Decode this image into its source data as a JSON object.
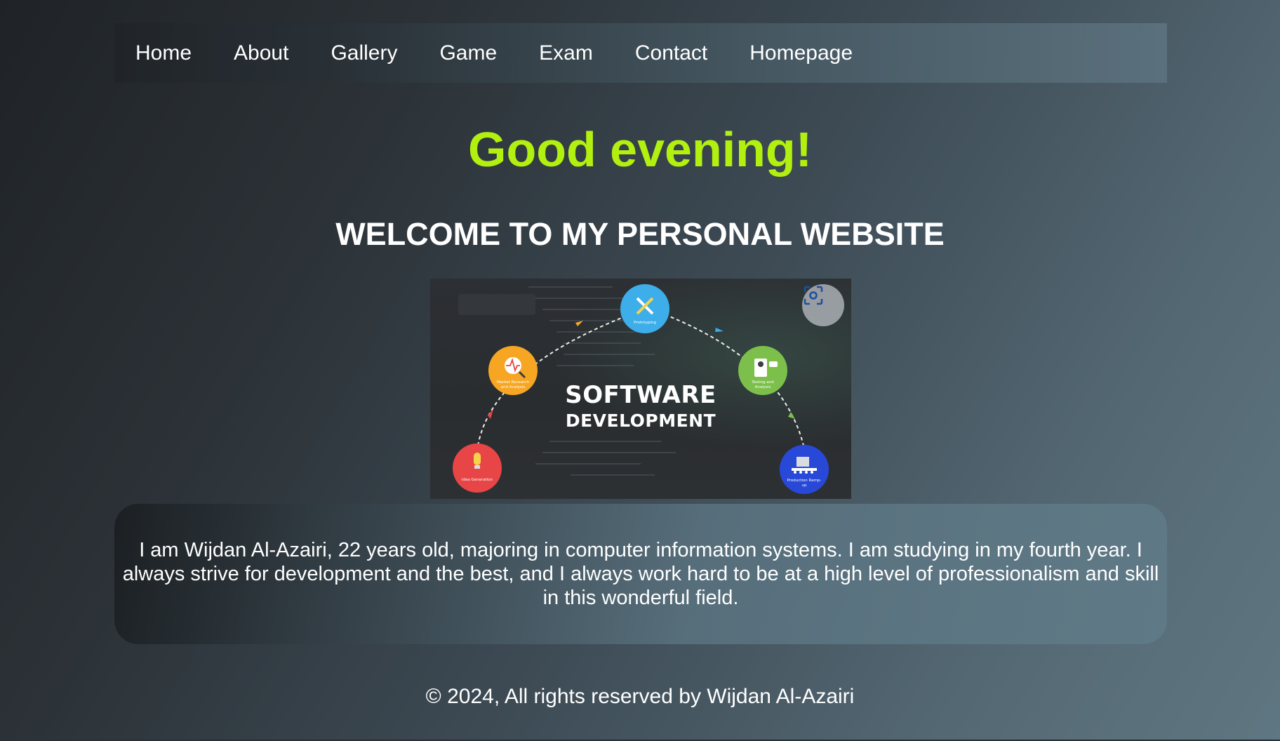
{
  "nav": {
    "items": [
      {
        "label": "Home"
      },
      {
        "label": "About"
      },
      {
        "label": "Gallery"
      },
      {
        "label": "Game"
      },
      {
        "label": "Exam"
      },
      {
        "label": "Contact"
      },
      {
        "label": "Homepage"
      }
    ]
  },
  "greeting": "Good evening!",
  "welcome": "WELCOME TO MY PERSONAL WEBSITE",
  "hero": {
    "title_line1": "SOFTWARE",
    "title_line2": "DEVELOPMENT",
    "stages": [
      {
        "label": "Idea Generation",
        "color": "#e84546"
      },
      {
        "label": "Market Research and Analysis",
        "color": "#f6a623"
      },
      {
        "label": "Prototyping",
        "color": "#3daee9"
      },
      {
        "label": "Testing and Analysis",
        "color": "#7cc04b"
      },
      {
        "label": "Production Ramp-up",
        "color": "#2848d8"
      }
    ]
  },
  "about": {
    "text": "I am Wijdan Al-Azairi, 22 years old, majoring in computer information systems. I am studying in my fourth year. I always strive for development and the best, and I always work hard to be at a high level of professionalism and skill in this wonderful field."
  },
  "footer": {
    "text": "© 2024, All rights reserved by Wijdan Al-Azairi"
  },
  "colors": {
    "greeting": "#b2f010",
    "text": "#ffffff"
  }
}
